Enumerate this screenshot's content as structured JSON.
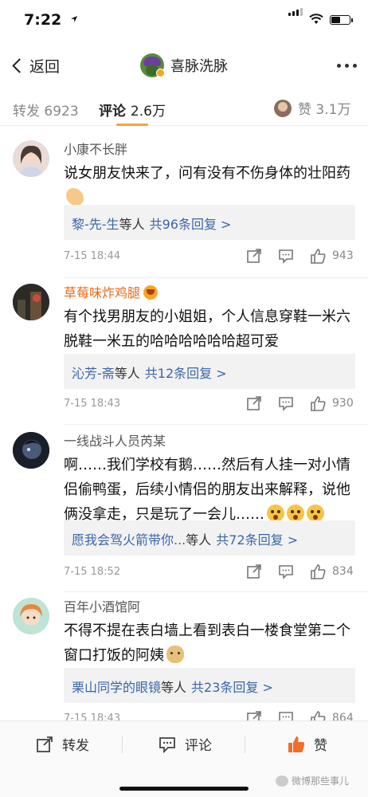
{
  "status_bar": {
    "time": "7:22"
  },
  "nav": {
    "back_label": "返回",
    "title": "喜脉洗脉"
  },
  "tabs": {
    "repost_label": "转发",
    "repost_count": "6923",
    "comment_label": "评论",
    "comment_count": "2.6万",
    "like_label": "赞",
    "like_count": "3.1万"
  },
  "comments": [
    {
      "name": "小康不长胖",
      "text": "说女朋友快来了，问有没有不伤身体的壮阳药",
      "replies_names": "黎-先-生",
      "replies_mid": "等人",
      "replies_count": "共96条回复 >",
      "time": "7-15 18:44",
      "likes": "943"
    },
    {
      "name": "草莓味炸鸡腿",
      "text": "有个找男朋友的小姐姐，个人信息穿鞋一米六脱鞋一米五的哈哈哈哈哈哈超可爱",
      "replies_names": "沁芳-斋",
      "replies_mid": "等人",
      "replies_count": "共12条回复 >",
      "time": "7-15 18:43",
      "likes": "930"
    },
    {
      "name": "一线战斗人员芮某",
      "text": "啊……我们学校有鹅……然后有人挂一对小情侣偷鸭蛋，后续小情侣的朋友出来解释，说他俩没拿走，只是玩了一会儿……",
      "replies_names": "愿我会驾火箭带你...",
      "replies_mid": "等人",
      "replies_count": "共72条回复 >",
      "time": "7-15 18:52",
      "likes": "834"
    },
    {
      "name": "百年小酒馆阿",
      "text": "不得不提在表白墙上看到表白一楼食堂第二个窗口打饭的阿姨",
      "replies_names": "栗山同学的眼镜",
      "replies_mid": "等人",
      "replies_count": "共23条回复 >",
      "time": "7-15 18:43",
      "likes": "864"
    }
  ],
  "bottom_bar": {
    "repost_label": "转发",
    "comment_label": "评论",
    "like_label": "赞",
    "watermark": "微博那些事儿"
  }
}
